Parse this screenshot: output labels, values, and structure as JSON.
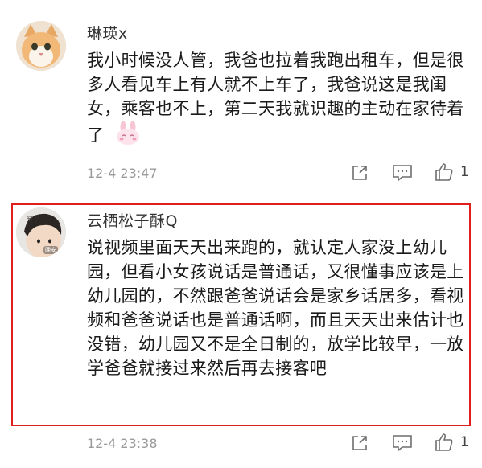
{
  "comments": [
    {
      "username": "琳瑛x",
      "text": "我小时候没人管，我爸也拉着我跑出租车，但是很多人看见车上有人就不上车了，我爸说这是我闺女，乘客也不上，第二天我就识趣的主动在家待着了",
      "emoji": "bunny-shy-emoji",
      "time": "12-4 23:47",
      "likes": "1",
      "avatar": "cat-avatar"
    },
    {
      "username": "云栖松子酥Q",
      "text": "说视频里面天天出来跑的，就认定人家没上幼儿园，但看小女孩说话是普通话，又很懂事应该是上幼儿园的，不然跟爸爸说话会是家乡话居多，看视频和爸爸说话也是普通话啊，而且天天出来估计也没错，幼儿园又不是全日制的，放学比较早，一放学爸爸就接过来然后再去接客吧",
      "time": "12-4 23:38",
      "likes": "1",
      "avatar": "child-avatar",
      "avatar_badges": [
        "睡了",
        "晚安"
      ]
    }
  ],
  "colors": {
    "highlight_border": "#e01e1e",
    "meta_gray": "#9a9a9a",
    "icon_gray": "#6e6e6e"
  }
}
